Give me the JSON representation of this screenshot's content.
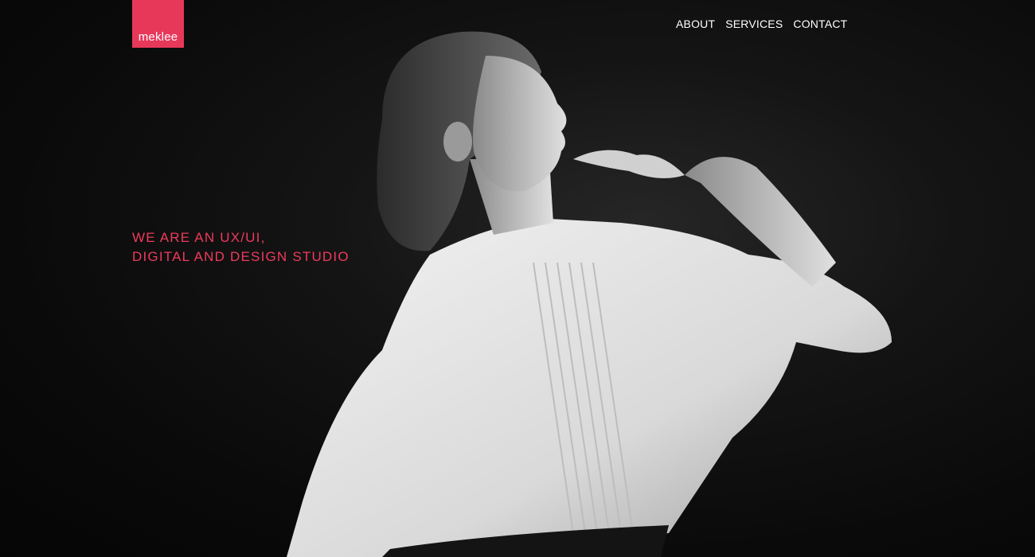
{
  "brand": {
    "logo_text": "meklee",
    "accent": "#e8385a"
  },
  "nav": {
    "items": [
      "ABOUT",
      "SERVICES",
      "CONTACT"
    ]
  },
  "hero": {
    "tagline_line1": "WE ARE AN UX/UI,",
    "tagline_line2": "DIGITAL AND DESIGN STUDIO",
    "tagline_color": "#ef3a5d"
  }
}
